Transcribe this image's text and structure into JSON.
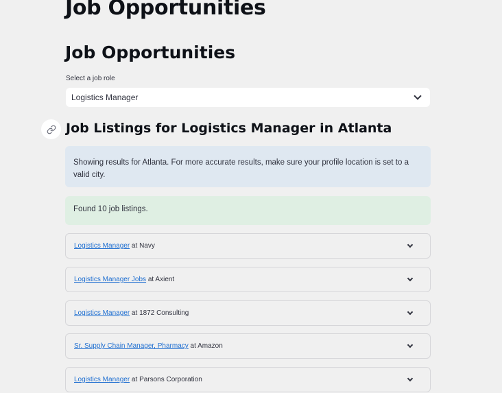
{
  "page": {
    "title": "Job Opportunities"
  },
  "section": {
    "title": "Job Opportunities"
  },
  "role_select": {
    "label": "Select a job role",
    "value": "Logistics Manager"
  },
  "listings": {
    "title": "Job Listings for Logistics Manager in Atlanta",
    "info": "Showing results for Atlanta. For more accurate results, make sure your profile location is set to a valid city.",
    "found": "Found 10 job listings.",
    "jobs": [
      {
        "title": "Logistics Manager",
        "connector": " at ",
        "company": "Navy"
      },
      {
        "title": "Logistics Manager Jobs",
        "connector": " at ",
        "company": "Axient"
      },
      {
        "title": "Logistics Manager",
        "connector": " at ",
        "company": "1872 Consulting"
      },
      {
        "title": "Sr. Supply Chain Manager, Pharmacy",
        "connector": " at ",
        "company": "Amazon"
      },
      {
        "title": "Logistics Manager",
        "connector": " at ",
        "company": "Parsons Corporation"
      }
    ]
  },
  "icons": {
    "anchor": "link-icon",
    "dropdown": "chevron-down-icon"
  },
  "colors": {
    "link": "#1f6fd1",
    "info_bg": "#dfe8f1",
    "success_bg": "#dfefe3",
    "page_bg": "#f0f0f0"
  }
}
